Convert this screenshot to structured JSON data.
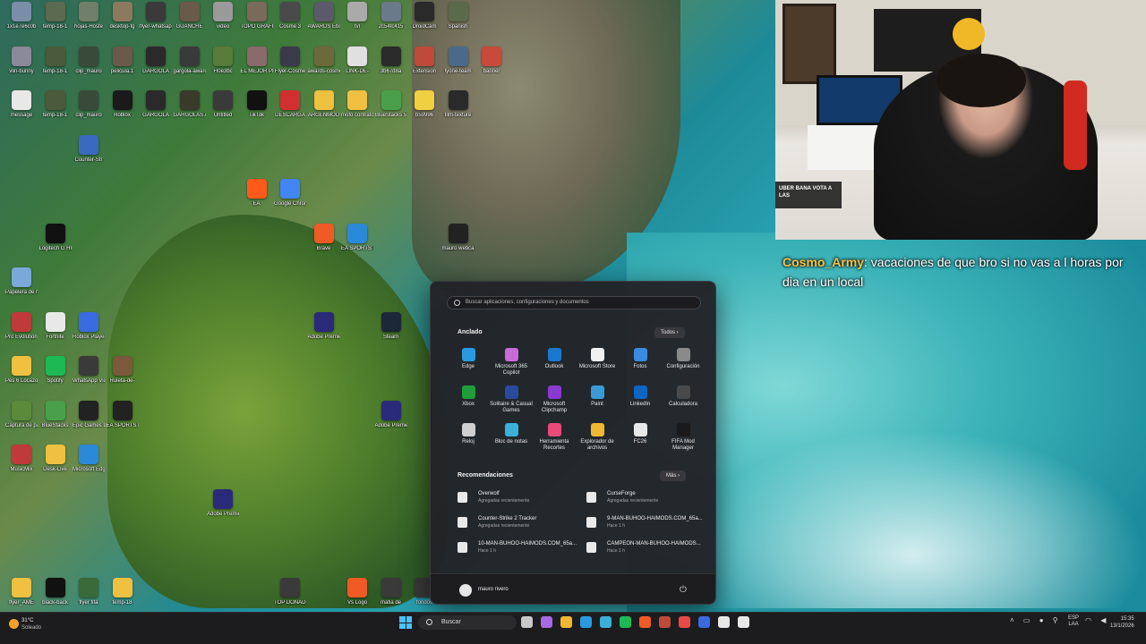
{
  "desktop": {
    "icons": [
      {
        "label": "1x1e7e6c0b",
        "col": 0,
        "row": 0,
        "color": "#7a8ea8"
      },
      {
        "label": "temp-18-1",
        "col": 1,
        "row": 0,
        "color": "#5b6a50"
      },
      {
        "label": "hojas-Hoste",
        "col": 2,
        "row": 0,
        "color": "#6f7f6a"
      },
      {
        "label": "desktop-fg",
        "col": 3,
        "row": 0,
        "color": "#8b7a60"
      },
      {
        "label": "flyer-whatsapp",
        "col": 4,
        "row": 0,
        "color": "#3a3a3a"
      },
      {
        "label": "GUANCHE",
        "col": 5,
        "row": 0,
        "color": "#6a5a4a"
      },
      {
        "label": "video",
        "col": 6,
        "row": 0,
        "color": "#9a9a9a"
      },
      {
        "label": "TOPO GRAFIA",
        "col": 7,
        "row": 0,
        "color": "#7a6a5a"
      },
      {
        "label": "Cosme 3",
        "col": 8,
        "row": 0,
        "color": "#4a4a4a"
      },
      {
        "label": "AWARDS Ebook",
        "col": 9,
        "row": 0,
        "color": "#5a5a6a"
      },
      {
        "label": "tvl",
        "col": 10,
        "row": 0,
        "color": "#aaaaaa"
      },
      {
        "label": "2c54fc415",
        "col": 11,
        "row": 0,
        "color": "#6a7a8a"
      },
      {
        "label": "DroidCam",
        "col": 12,
        "row": 0,
        "color": "#2a2a2a"
      },
      {
        "label": "Spanish",
        "col": 13,
        "row": 0,
        "color": "#5a6a4a"
      },
      {
        "label": "vlin-bunny",
        "col": 0,
        "row": 1,
        "color": "#8a8a9a"
      },
      {
        "label": "temp-18-1",
        "col": 1,
        "row": 1,
        "color": "#4a5a3a"
      },
      {
        "label": "clip_mauro",
        "col": 2,
        "row": 1,
        "color": "#3a4a3a"
      },
      {
        "label": "pelicula.1",
        "col": 3,
        "row": 1,
        "color": "#6a5a4a"
      },
      {
        "label": "GARGOLA",
        "col": 4,
        "row": 1,
        "color": "#2a2a2a"
      },
      {
        "label": "gargola-awards",
        "col": 5,
        "row": 1,
        "color": "#3a3a3a"
      },
      {
        "label": "Fl0e3bc",
        "col": 6,
        "row": 1,
        "color": "#5a7a3a"
      },
      {
        "label": "EL MEJOR PHOTIK",
        "col": 7,
        "row": 1,
        "color": "#8a6a6a"
      },
      {
        "label": "Flyer-Cosme",
        "col": 8,
        "row": 1,
        "color": "#3a3a4a"
      },
      {
        "label": "awards-cosmo",
        "col": 9,
        "row": 1,
        "color": "#6a6a3a"
      },
      {
        "label": "LINK-DE-",
        "col": 10,
        "row": 1,
        "color": "#e0e0e0"
      },
      {
        "label": "3b67d8a",
        "col": 11,
        "row": 1,
        "color": "#2a2a2a"
      },
      {
        "label": "Extension",
        "col": 12,
        "row": 1,
        "color": "#c04a3a"
      },
      {
        "label": "fyone-team",
        "col": 13,
        "row": 1,
        "color": "#4a6a8a"
      },
      {
        "label": "banner",
        "col": 14,
        "row": 1,
        "color": "#c84a3a"
      },
      {
        "label": "message",
        "col": 0,
        "row": 2,
        "color": "#e8e8e8"
      },
      {
        "label": "temp-18-1",
        "col": 1,
        "row": 2,
        "color": "#4a5a3a"
      },
      {
        "label": "clip_mauro",
        "col": 2,
        "row": 2,
        "color": "#3a4a3a"
      },
      {
        "label": "Roblox",
        "col": 3,
        "row": 2,
        "color": "#1a1a1a"
      },
      {
        "label": "GARGOLA",
        "col": 4,
        "row": 2,
        "color": "#2a2a2a"
      },
      {
        "label": "GARGOLAS AWARDS",
        "col": 5,
        "row": 2,
        "color": "#3a3a2a"
      },
      {
        "label": "Untitled",
        "col": 6,
        "row": 2,
        "color": "#3a3a3a"
      },
      {
        "label": "TikTok",
        "col": 7,
        "row": 2,
        "color": "#111111"
      },
      {
        "label": "DESCARGA",
        "col": 8,
        "row": 2,
        "color": "#d03030"
      },
      {
        "label": "ARGENMOD",
        "col": 9,
        "row": 2,
        "color": "#f0c040"
      },
      {
        "label": "mofo contrato",
        "col": 10,
        "row": 2,
        "color": "#f0c040"
      },
      {
        "label": "BlueStacks 5",
        "col": 11,
        "row": 2,
        "color": "#4aa04a"
      },
      {
        "label": "b59996",
        "col": 12,
        "row": 2,
        "color": "#f0d040"
      },
      {
        "label": "film-texture",
        "col": 13,
        "row": 2,
        "color": "#2a2a2a"
      },
      {
        "label": "Counter-Str",
        "col": 2,
        "row": 3,
        "color": "#3a6ac0"
      },
      {
        "label": "EA",
        "col": 7,
        "row": 4,
        "color": "#ff5a1a"
      },
      {
        "label": "Spotify",
        "col": 1,
        "row": 8,
        "color": "#1db954"
      },
      {
        "label": "Papelera de reciclaje",
        "col": 0,
        "row": 6,
        "color": "#7aa8d8"
      },
      {
        "label": "Pro Evolution Soccer 6",
        "col": 0,
        "row": 7,
        "color": "#c03a3a"
      },
      {
        "label": "Fortnite",
        "col": 1,
        "row": 7,
        "color": "#e8e8e8"
      },
      {
        "label": "Roblox Player",
        "col": 2,
        "row": 7,
        "color": "#3a6ae0"
      },
      {
        "label": "Epic Games Launcher",
        "col": 2,
        "row": 9,
        "color": "#222222"
      },
      {
        "label": "EA SPORTS FC 26",
        "col": 3,
        "row": 9,
        "color": "#222222"
      },
      {
        "label": "Microsoft Edge",
        "col": 2,
        "row": 10,
        "color": "#2a8ad8"
      },
      {
        "label": "Logitech G HUB",
        "col": 1,
        "row": 5,
        "color": "#111111"
      },
      {
        "label": "Google Chrome",
        "col": 8,
        "row": 4,
        "color": "#4285f4"
      },
      {
        "label": "Brave",
        "col": 9,
        "row": 5,
        "color": "#f05a24"
      },
      {
        "label": "EA SPORTS FC",
        "col": 10,
        "row": 5,
        "color": "#2a8ad8"
      },
      {
        "label": "Steam",
        "col": 11,
        "row": 7,
        "color": "#1b2838"
      },
      {
        "label": "Adobe Premiere",
        "col": 9,
        "row": 7,
        "color": "#2a2a7a"
      },
      {
        "label": "Adobe Premiere",
        "col": 6,
        "row": 11,
        "color": "#2a2a7a"
      },
      {
        "label": "Adobe Premiere",
        "col": 11,
        "row": 9,
        "color": "#2a2a7a"
      },
      {
        "label": "mauro webcam",
        "col": 13,
        "row": 5,
        "color": "#222222"
      },
      {
        "label": "Captura de pantalla",
        "col": 0,
        "row": 9,
        "color": "#5a8a3a"
      },
      {
        "label": "BlueStacks",
        "col": 1,
        "row": 9,
        "color": "#4aa04a"
      },
      {
        "label": "Pes 6 Locazos",
        "col": 0,
        "row": 8,
        "color": "#f0c040"
      },
      {
        "label": "WhatsApp Video 2025",
        "col": 2,
        "row": 8,
        "color": "#3a3a3a"
      },
      {
        "label": "Ruleta-de-",
        "col": 3,
        "row": 8,
        "color": "#7a5a3a"
      },
      {
        "label": "MusicMix",
        "col": 0,
        "row": 10,
        "color": "#c03a3a"
      },
      {
        "label": "Desk-Live",
        "col": 1,
        "row": 10,
        "color": "#f0c040"
      },
      {
        "label": "flyer_AME",
        "col": 0,
        "row": 13,
        "color": "#f0c040"
      },
      {
        "label": "black-back",
        "col": 1,
        "row": 13,
        "color": "#111111"
      },
      {
        "label": "flyer fifa",
        "col": 2,
        "row": 13,
        "color": "#3a6a3a"
      },
      {
        "label": "temp-18",
        "col": 3,
        "row": 13,
        "color": "#f0c040"
      },
      {
        "label": "TOP DONADOR",
        "col": 8,
        "row": 13,
        "color": "#3a3a3a"
      },
      {
        "label": "Vs Logo",
        "col": 10,
        "row": 13,
        "color": "#f05a24"
      },
      {
        "label": "mafia de",
        "col": 11,
        "row": 13,
        "color": "#3a3a3a"
      },
      {
        "label": "fondos",
        "col": 12,
        "row": 13,
        "color": "#3a3a3a"
      }
    ]
  },
  "webcam": {
    "notification": "UBER BANA VOTA A LAS"
  },
  "chat": {
    "username": "Cosmo_Army",
    "message": ": vacaciones de que bro si no vas a l horas por dia en un local"
  },
  "start_menu": {
    "search_placeholder": "Buscar aplicaciones, configuraciones y documentos",
    "pinned_title": "Anclado",
    "all_button": "Todos",
    "pinned_apps": [
      {
        "label": "Edge",
        "color": "#2a9ae0"
      },
      {
        "label": "Microsoft 365 Copilot",
        "color": "#c86ad8"
      },
      {
        "label": "Outlook",
        "color": "#1a78d0"
      },
      {
        "label": "Microsoft Store",
        "color": "#f0f0f0"
      },
      {
        "label": "Fotos",
        "color": "#3a8ae0"
      },
      {
        "label": "Configuración",
        "color": "#8a8a8a"
      },
      {
        "label": "Xbox",
        "color": "#1e9e3a"
      },
      {
        "label": "Solitaire & Casual Games",
        "color": "#2a4aa0"
      },
      {
        "label": "Microsoft Clipchamp",
        "color": "#8a3ad0"
      },
      {
        "label": "Paint",
        "color": "#3a9ad8"
      },
      {
        "label": "LinkedIn",
        "color": "#0a66c2"
      },
      {
        "label": "Calculadora",
        "color": "#4a4a4a"
      },
      {
        "label": "Reloj",
        "color": "#cfcfcf"
      },
      {
        "label": "Bloc de notas",
        "color": "#3ab0d8"
      },
      {
        "label": "Herramienta Recortes",
        "color": "#e84a7a"
      },
      {
        "label": "Explorador de archivos",
        "color": "#f0b830"
      },
      {
        "label": "FC26",
        "color": "#e8e8e8"
      },
      {
        "label": "FIFA Mod Manager",
        "color": "#1a1a1a"
      }
    ],
    "recs_title": "Recomendaciones",
    "more_button": "Más",
    "recommendations": [
      {
        "title": "Overwolf",
        "subtitle": "Agregadas recientemente"
      },
      {
        "title": "CurseForge",
        "subtitle": "Agregadas recientemente"
      },
      {
        "title": "Counter-Strike 2 Tracker",
        "subtitle": "Agregadas recientemente"
      },
      {
        "title": "9-MAN-BUHOO-HAIMODS.COM_65a...",
        "subtitle": "Hace 1 h"
      },
      {
        "title": "10-MAN-BUHOO-HAIMODS.COM_65a...",
        "subtitle": "Hace 1 h"
      },
      {
        "title": "CAMPEON-MAN-BUHOO-HAIMODS...",
        "subtitle": "Hace 1 h"
      }
    ],
    "user_name": "mauro rivero",
    "power_icon": "⏻"
  },
  "taskbar": {
    "weather_temp": "31°C",
    "weather_desc": "Soleado",
    "search_label": "Buscar",
    "pinned": [
      {
        "name": "task-view",
        "color": "#c8c8c8"
      },
      {
        "name": "copilot",
        "color": "#a86ae0"
      },
      {
        "name": "file-explorer",
        "color": "#f0b830"
      },
      {
        "name": "edge",
        "color": "#2a9ae0"
      },
      {
        "name": "notepad",
        "color": "#3ab0d8"
      },
      {
        "name": "spotify",
        "color": "#1db954"
      },
      {
        "name": "brave",
        "color": "#f05a24"
      },
      {
        "name": "chrome",
        "color": "#c04a3a"
      },
      {
        "name": "obs",
        "color": "#e84a4a"
      },
      {
        "name": "store",
        "color": "#3a6ae0"
      },
      {
        "name": "capcut",
        "color": "#e8e8e8"
      },
      {
        "name": "game",
        "color": "#e8e8e8"
      }
    ],
    "lang_top": "ESP",
    "lang_bottom": "LAA",
    "time": "15:35",
    "date": "13/1/2026"
  }
}
